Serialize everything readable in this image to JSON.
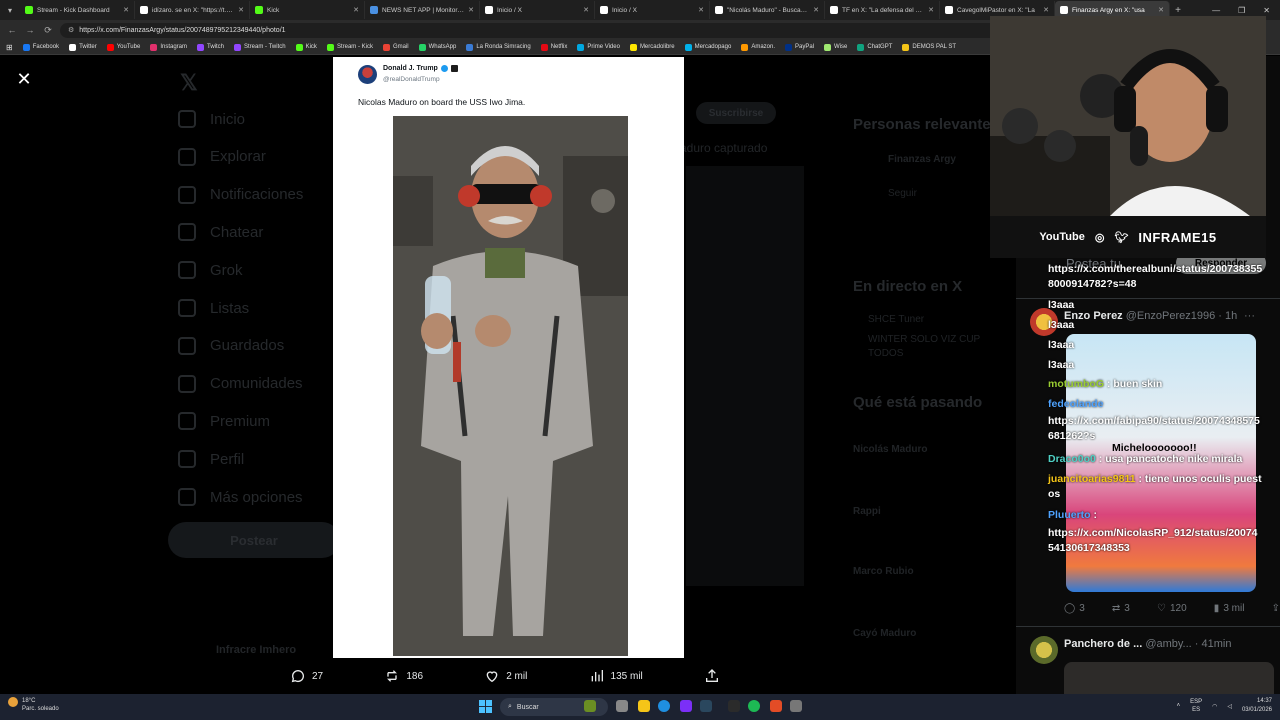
{
  "browser": {
    "tabs": [
      {
        "title": "Stream - Kick Dashboard",
        "color": "#53fc18"
      },
      {
        "title": "idízaro. se en X: \"https://t.co/ZbF",
        "color": "#ffffff"
      },
      {
        "title": "Kick",
        "color": "#53fc18"
      },
      {
        "title": "NEWS NET APP | Monitoreo de",
        "color": "#4a90e2"
      },
      {
        "title": "Inicio / X",
        "color": "#ffffff"
      },
      {
        "title": "Inicio / X",
        "color": "#ffffff"
      },
      {
        "title": "\"Nicolás Maduro\" - Buscar / X",
        "color": "#ffffff"
      },
      {
        "title": "TF en X: \"La defensa del búnker",
        "color": "#ffffff"
      },
      {
        "title": "CavegolMiPastor en X: \"La",
        "color": "#ffffff"
      },
      {
        "title": "Finanzas Argy en X: \"usa",
        "color": "#ffffff",
        "active": true
      }
    ],
    "url": "https://x.com/FinanzasArgy/status/2007489795212349440/photo/1",
    "bookmarks": [
      {
        "label": "Facebook",
        "color": "#1877f2"
      },
      {
        "label": "Twitter",
        "color": "#ffffff"
      },
      {
        "label": "YouTube",
        "color": "#ff0000"
      },
      {
        "label": "Instagram",
        "color": "#e1306c"
      },
      {
        "label": "Twitch",
        "color": "#9146ff"
      },
      {
        "label": "Stream - Twitch",
        "color": "#9146ff"
      },
      {
        "label": "Kick",
        "color": "#53fc18"
      },
      {
        "label": "Stream - Kick",
        "color": "#53fc18"
      },
      {
        "label": "Gmail",
        "color": "#ea4335"
      },
      {
        "label": "WhatsApp",
        "color": "#25d366"
      },
      {
        "label": "La Ronda Simracing",
        "color": "#3a7bd5"
      },
      {
        "label": "Netflix",
        "color": "#e50914"
      },
      {
        "label": "Prime Video",
        "color": "#00a8e1"
      },
      {
        "label": "Mercadolibre",
        "color": "#ffe600"
      },
      {
        "label": "Mercadopago",
        "color": "#00b1ea"
      },
      {
        "label": "Amazon.",
        "color": "#ff9900"
      },
      {
        "label": "PayPal",
        "color": "#003087"
      },
      {
        "label": "Wise",
        "color": "#9fe870"
      },
      {
        "label": "ChatGPT",
        "color": "#10a37f"
      },
      {
        "label": "DEMOS PAL ST",
        "color": "#f5c518"
      }
    ]
  },
  "x_bg": {
    "nav": [
      "Inicio",
      "Explorar",
      "Notificaciones",
      "Chatear",
      "Grok",
      "Listas",
      "Guardados",
      "Comunidades",
      "Premium",
      "Perfil",
      "Más opciones"
    ],
    "post_button": "Postear",
    "bottom_user": "Infracre Imhero",
    "right_headings": [
      "Personas relevantes",
      "En directo en X",
      "Qué está pasando"
    ],
    "right_lines": [
      "Finanzas Argy",
      "Seguir",
      "SHCE Tuner",
      "WINTER SOLO VIZ CUP",
      "TODOS",
      "Nicolás Maduro",
      "Rappi",
      "Marco Rubio",
      "Cayó Maduro"
    ],
    "subscribe": "Suscribirse",
    "caption_bg": "aduro capturado"
  },
  "modal": {
    "author_name": "Donald J. Trump",
    "author_handle": "@realDonaldTrump",
    "post_text": "Nicolas Maduro on board the USS Iwo Jima.",
    "stats": {
      "replies": "27",
      "reposts": "186",
      "likes": "2 mil",
      "views": "135 mil"
    }
  },
  "stream": {
    "socials": {
      "youtube": "YouTube",
      "brand": "INFRAME15"
    },
    "chat": [
      {
        "text": "https://x.com/therealbuni/status/2007383558000914782?s=48",
        "color": "#ffffff"
      },
      {
        "user": "l3aaa",
        "msg": "",
        "color": "#ffffff"
      },
      {
        "user": "l3aaa",
        "msg": "",
        "color": "#ffffff"
      },
      {
        "user": "l3aaa",
        "msg": "",
        "color": "#ffffff"
      },
      {
        "user": "l3aaa",
        "msg": "",
        "color": "#ffffff"
      },
      {
        "user": "motumboG",
        "msg": ": buen skin",
        "color": "#9acd32"
      },
      {
        "user": "fedeolande",
        "msg": "",
        "color": "#4fa3ff"
      },
      {
        "text": "https://x.com/fabipa90/status/20074348575681262?s",
        "color": "#ffffff"
      },
      {
        "text": "Michelooooooo!!",
        "color": "#ffffff"
      },
      {
        "user": "Draco0o0",
        "msg": ": usa pancatoche nike mirala",
        "color": "#4fd1c5"
      },
      {
        "user": "juancitoarias9811",
        "msg": ": tiene unos oculis puestos",
        "color": "#f5c518"
      },
      {
        "user": "Pluuerto",
        "msg": ":",
        "color": "#4fa3ff"
      },
      {
        "text": "https://x.com/NicolasRP_912/status/2007454130617348353",
        "color": "#ffffff"
      }
    ],
    "tweet1": {
      "name": "Enzo Perez",
      "handle": "@EnzoPerez1996",
      "time": "· 1h",
      "replies": "3",
      "reposts": "3",
      "likes": "120",
      "views": "3 mil"
    },
    "tweet2": {
      "name": "Panchero de ...",
      "handle": "@amby...",
      "time": "· 41min"
    },
    "header_partial": "Postea tu",
    "header_btn": "Responder"
  },
  "taskbar": {
    "weather_temp": "18°C",
    "weather_desc": "Parc. soleado",
    "search": "Buscar",
    "lang": "ESP",
    "lang2": "ES",
    "time": "14:37",
    "date": "03/01/2026"
  }
}
